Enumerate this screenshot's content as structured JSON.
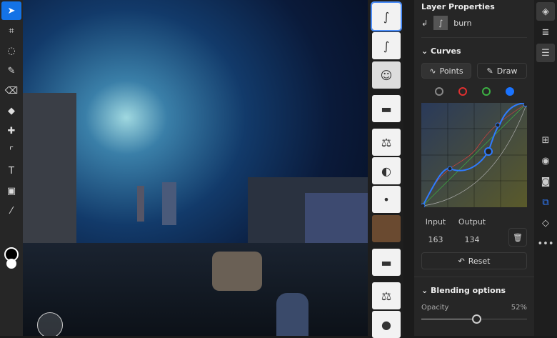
{
  "toolbar": {
    "tools": [
      "move",
      "transform",
      "lasso",
      "brush",
      "eraser",
      "fill",
      "healing",
      "crop",
      "type",
      "image",
      "eyedropper"
    ]
  },
  "layers": {
    "items": [
      {
        "icon": "curves-icon",
        "selected": true,
        "clipped": true
      },
      {
        "icon": "curves-icon",
        "clipped": true
      },
      {
        "icon": "photo-boy"
      },
      {
        "icon": "mask-smudge"
      },
      {
        "icon": "balance-icon",
        "clipped": true
      },
      {
        "icon": "brightness-icon",
        "clipped": true
      },
      {
        "icon": "mask-smudge",
        "clipped": true
      },
      {
        "icon": "photo-room"
      },
      {
        "icon": "mask-smudge"
      },
      {
        "icon": "balance-icon",
        "clipped": true
      },
      {
        "icon": "mask-smudge",
        "clipped": true
      }
    ]
  },
  "properties": {
    "title": "Layer Properties",
    "layer_name": "burn",
    "curves_label": "Curves",
    "points_label": "Points",
    "draw_label": "Draw",
    "channels": [
      "#888888",
      "#e03030",
      "#3cb043",
      "#1a73ff"
    ],
    "selected_channel": 3,
    "input_label": "Input",
    "output_label": "Output",
    "input_value": "163",
    "output_value": "134",
    "reset_label": "Reset",
    "blending_label": "Blending options",
    "opacity_label": "Opacity",
    "opacity_value": "52%",
    "opacity": 0.52
  },
  "colors": {
    "accent": "#1473e6",
    "curve": "#2f7bff"
  }
}
